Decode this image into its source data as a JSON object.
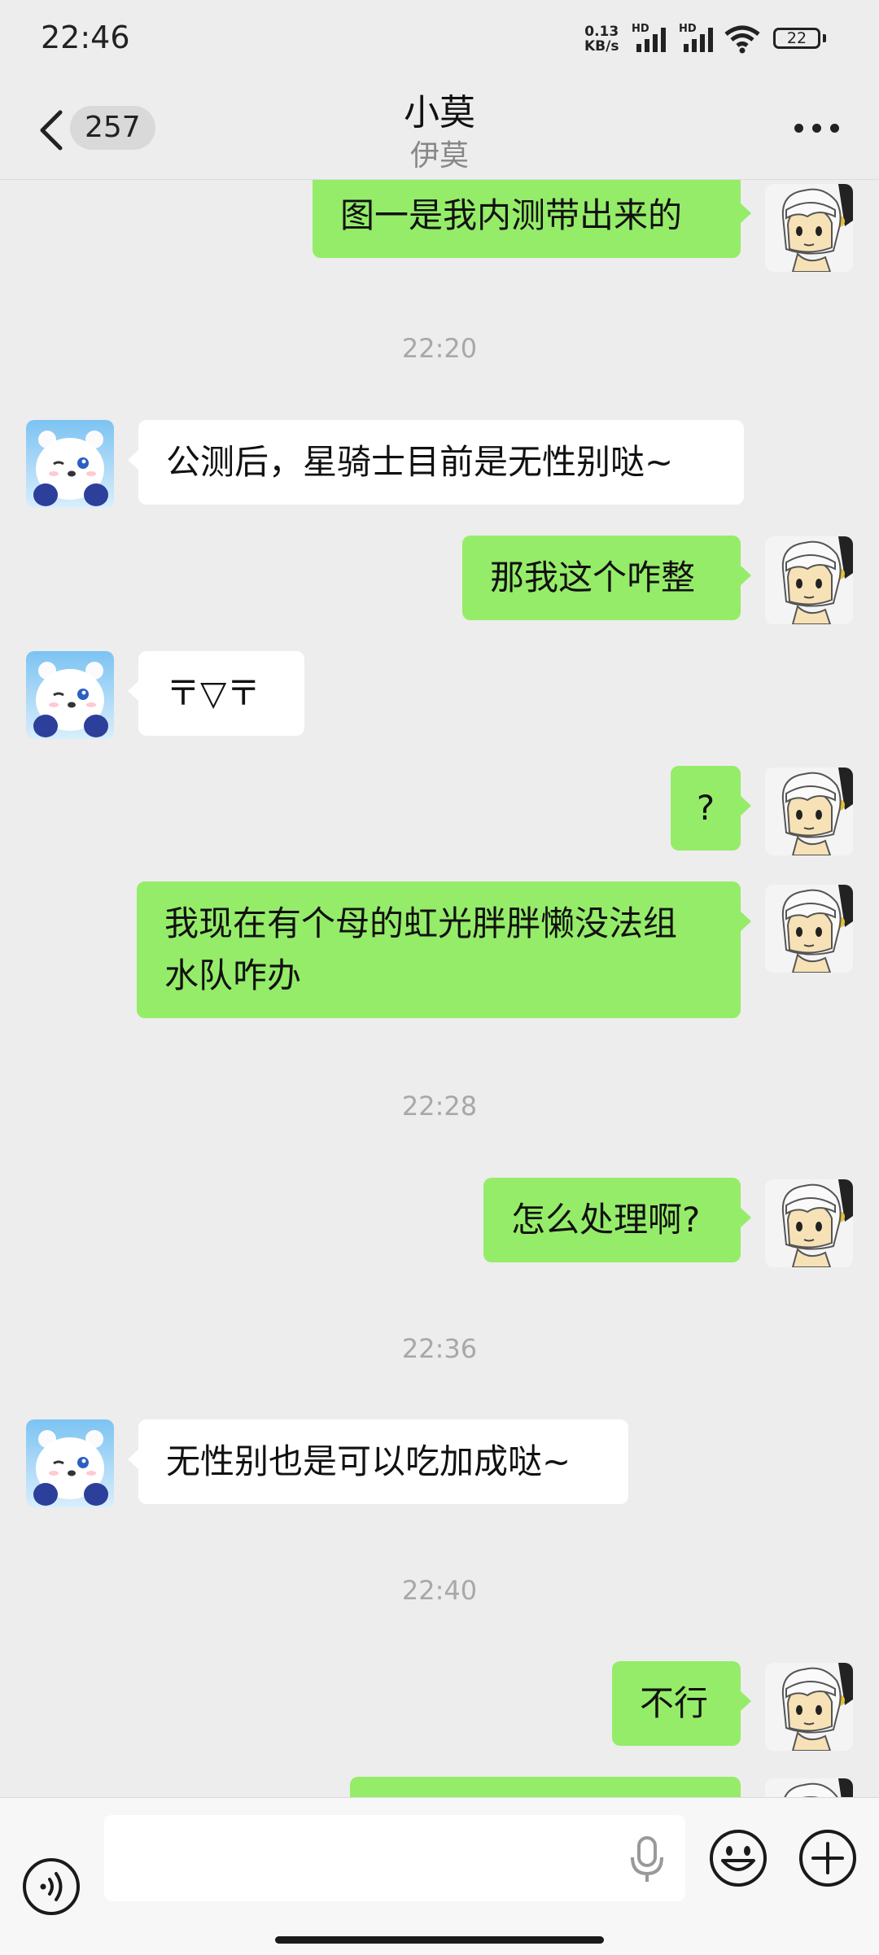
{
  "status_bar": {
    "time": "22:46",
    "net_speed_value": "0.13",
    "net_speed_unit": "KB/s",
    "signal_1_label": "HD",
    "signal_2_label": "HD",
    "battery": "22"
  },
  "header": {
    "unread_count": "257",
    "title": "小莫",
    "subtitle": "伊莫"
  },
  "messages": [
    {
      "side": "out",
      "text": "图一是我内测带出来的"
    },
    {
      "time": "22:20"
    },
    {
      "side": "in",
      "text": "公测后，星骑士目前是无性别哒~"
    },
    {
      "side": "out",
      "text": "那我这个咋整"
    },
    {
      "side": "in",
      "text": "〒▽〒"
    },
    {
      "side": "out",
      "text": "?"
    },
    {
      "side": "out",
      "text_line1": "我现在有个母的虹光胖胖懒没法组",
      "text_line2": "水队咋办"
    },
    {
      "time": "22:28"
    },
    {
      "side": "out",
      "text": "怎么处理啊?"
    },
    {
      "time": "22:36"
    },
    {
      "side": "in",
      "text": "无性别也是可以吃加成哒~"
    },
    {
      "time": "22:40"
    },
    {
      "side": "out",
      "text": "不行"
    },
    {
      "side": "out",
      "text": ""
    }
  ],
  "input_bar": {
    "placeholder": ""
  },
  "icons": {
    "back": "chevron-left-icon",
    "more": "more-dots-icon",
    "voice": "voice-toggle-icon",
    "mic": "microphone-icon",
    "emoji": "emoji-icon",
    "plus": "plus-icon"
  },
  "colors": {
    "outgoing_bubble": "#95ec69",
    "incoming_bubble": "#ffffff",
    "background": "#ededed"
  }
}
